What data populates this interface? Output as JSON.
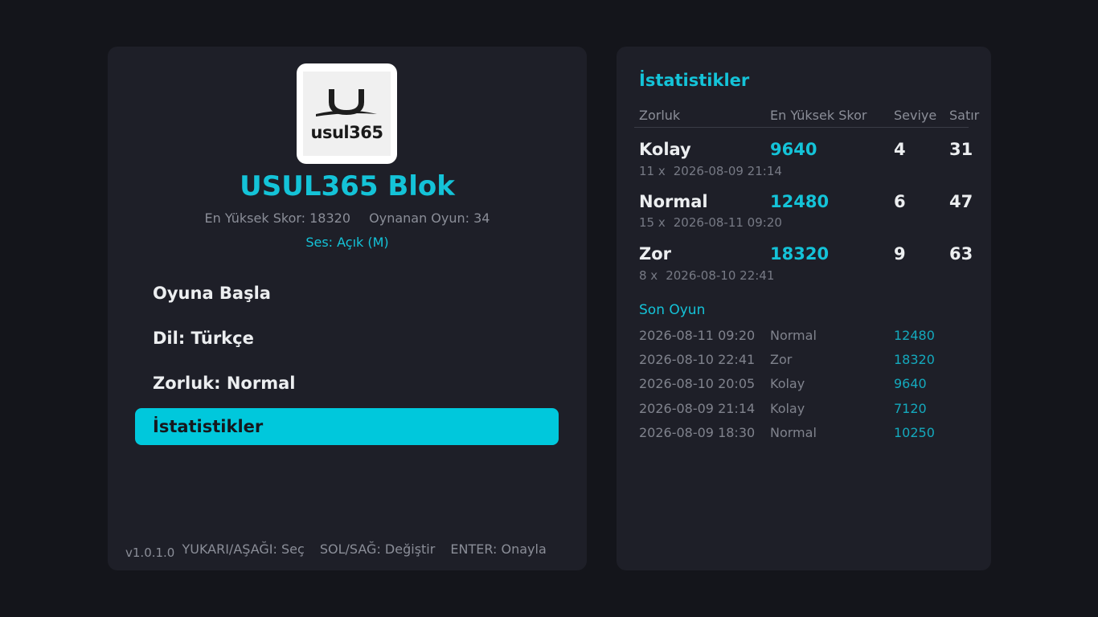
{
  "app": {
    "logo_text": "usul365",
    "title": "USUL365 Blok",
    "high_score": "En Yüksek Skor: 18320",
    "games_played": "Oynanan Oyun: 34",
    "sound": "Ses: Açık (M)"
  },
  "menu": [
    {
      "label": "Oyuna Başla",
      "selected": false
    },
    {
      "label": "Dil: Türkçe",
      "selected": false
    },
    {
      "label": "Zorluk: Normal",
      "selected": false
    },
    {
      "label": "İstatistikler",
      "selected": true
    }
  ],
  "footer": {
    "version": "v1.0.1.0",
    "hint_nav": "YUKARI/AŞAĞI: Seç",
    "hint_change": "SOL/SAĞ: Değiştir",
    "hint_confirm": "ENTER: Onayla"
  },
  "stats": {
    "title": "İstatistikler",
    "headers": [
      "Zorluk",
      "En Yüksek Skor",
      "Seviye",
      "Satır"
    ],
    "rows": [
      {
        "difficulty": "Kolay",
        "best": "9640",
        "level": "4",
        "lines": "31",
        "plays": "11 x",
        "date": "2026-08-09 21:14"
      },
      {
        "difficulty": "Normal",
        "best": "12480",
        "level": "6",
        "lines": "47",
        "plays": "15 x",
        "date": "2026-08-11 09:20"
      },
      {
        "difficulty": "Zor",
        "best": "18320",
        "level": "9",
        "lines": "63",
        "plays": "8 x",
        "date": "2026-08-10 22:41"
      }
    ],
    "last_title": "Son Oyun",
    "recent": [
      {
        "date": "2026-08-11 09:20",
        "difficulty": "Normal",
        "score": "12480"
      },
      {
        "date": "2026-08-10 22:41",
        "difficulty": "Zor",
        "score": "18320"
      },
      {
        "date": "2026-08-10 20:05",
        "difficulty": "Kolay",
        "score": "9640"
      },
      {
        "date": "2026-08-09 21:14",
        "difficulty": "Kolay",
        "score": "7120"
      },
      {
        "date": "2026-08-09 18:30",
        "difficulty": "Normal",
        "score": "10250"
      }
    ]
  },
  "colors": {
    "background": "#14151b",
    "panel": "#1e1f28",
    "accent": "#00c8dc"
  }
}
